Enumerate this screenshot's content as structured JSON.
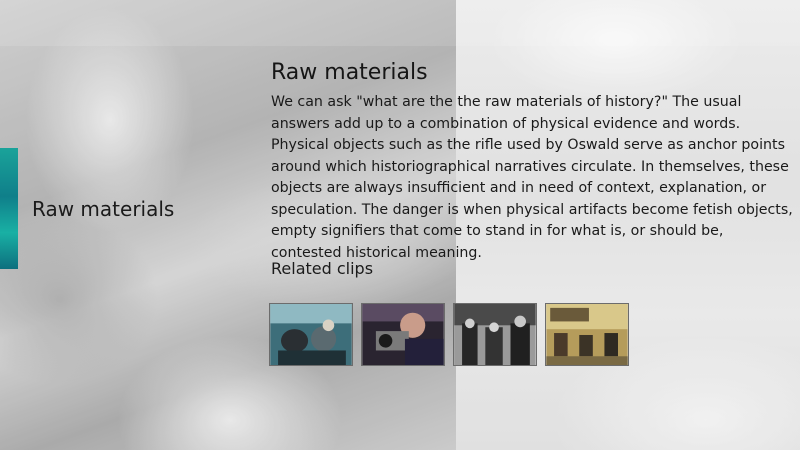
{
  "section": {
    "label": "Raw materials"
  },
  "article": {
    "title": "Raw materials",
    "body": "We can ask \"what are the the raw materials of history?\" The usual answers add up to a combination of physical evidence and words. Physical objects such as the rifle used by Oswald serve as anchor points around which historiographical narratives circulate. In themselves, these objects are always insufficient and in need of context, explanation, or speculation. The danger is when physical artifacts become fetish objects, empty signifiers that come to stand in for what is, or should be, contested historical meaning."
  },
  "related": {
    "heading": "Related clips",
    "clips": [
      {
        "icon": "car-scene-thumbnail"
      },
      {
        "icon": "camera-operator-thumbnail"
      },
      {
        "icon": "men-in-hats-thumbnail"
      },
      {
        "icon": "tv-studio-thumbnail"
      }
    ]
  },
  "colors": {
    "accent_tab": "#1aa39a",
    "text": "#1a1a1a"
  }
}
